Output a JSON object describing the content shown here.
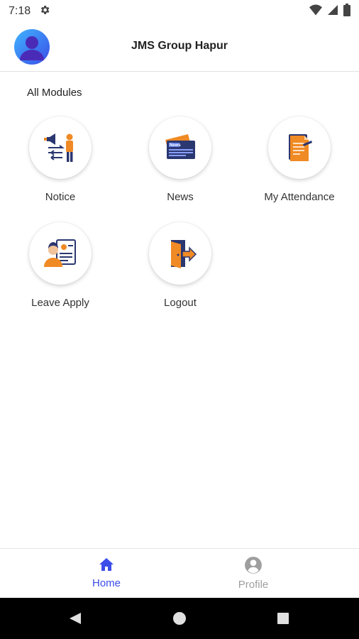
{
  "status_bar": {
    "time": "7:18"
  },
  "header": {
    "title": "JMS Group Hapur"
  },
  "section": {
    "title": "All Modules"
  },
  "modules": [
    {
      "label": "Notice",
      "icon": "notice-icon"
    },
    {
      "label": "News",
      "icon": "news-icon"
    },
    {
      "label": "My Attendance",
      "icon": "attendance-icon"
    },
    {
      "label": "Leave Apply",
      "icon": "leave-apply-icon"
    },
    {
      "label": "Logout",
      "icon": "logout-icon"
    }
  ],
  "news_icon_text": "News",
  "bottom_nav": {
    "items": [
      {
        "label": "Home",
        "icon": "home-icon",
        "active": true
      },
      {
        "label": "Profile",
        "icon": "profile-icon",
        "active": false
      }
    ]
  },
  "colors": {
    "accent": "#3b4de8",
    "inactive": "#9e9e9e",
    "icon_orange": "#f08a24",
    "icon_navy": "#2b3770"
  }
}
